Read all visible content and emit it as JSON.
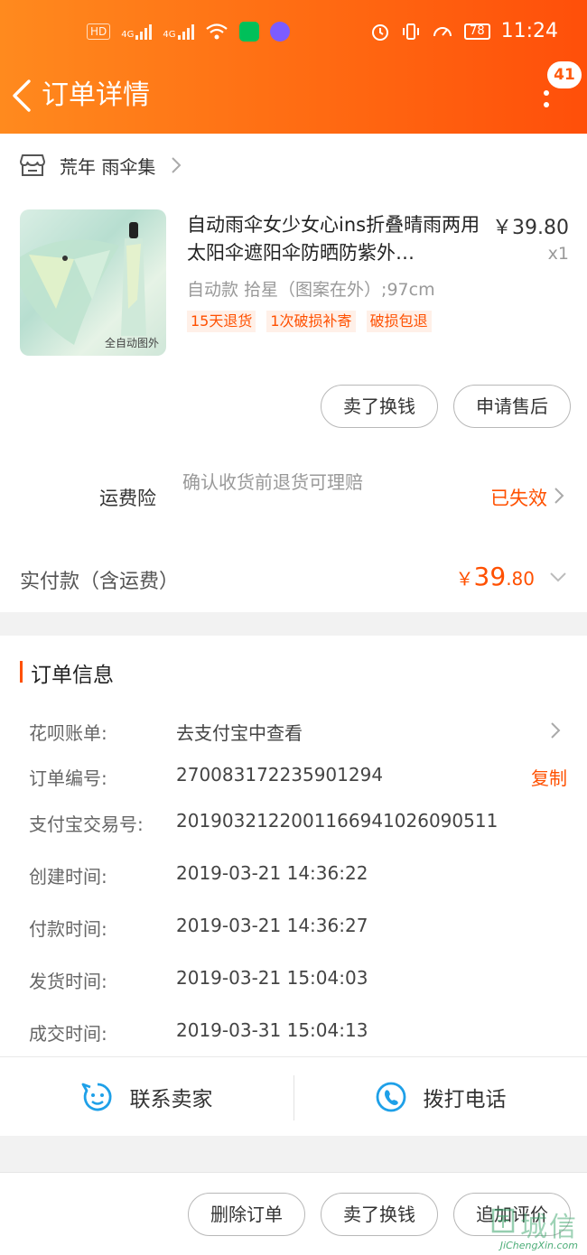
{
  "status_bar": {
    "left_chips": [
      "HD",
      "4G",
      "4G"
    ],
    "battery": "78",
    "time": "11:24"
  },
  "header": {
    "title": "订单详情",
    "notification_count": "41"
  },
  "store": {
    "name": "荒年 雨伞集"
  },
  "product": {
    "title": "自动雨伞女少女心ins折叠晴雨两用太阳伞遮阳伞防晒防紫外…",
    "price": "￥39.80",
    "quantity": "x1",
    "sku": "自动款 拾星（图案在外）;97cm",
    "image_label": "全自动图外",
    "tags": [
      "15天退货",
      "1次破损补寄",
      "破损包退"
    ]
  },
  "item_actions": {
    "sell_label": "卖了换钱",
    "after_sale_label": "申请售后"
  },
  "insurance": {
    "label": "运费险",
    "description": "确认收货前退货可理赔",
    "status": "已失效"
  },
  "payment": {
    "label": "实付款（含运费）",
    "currency": "￥",
    "amount_int": "39",
    "amount_dec": ".80"
  },
  "order_info": {
    "title": "订单信息",
    "rows": [
      {
        "label": "花呗账单:",
        "value": "去支付宝中查看"
      },
      {
        "label": "订单编号:",
        "value": "270083172235901294",
        "action": "复制"
      },
      {
        "label": "支付宝交易号:",
        "value": "2019032122001166941026090511"
      },
      {
        "label": "创建时间:",
        "value": "2019-03-21 14:36:22"
      },
      {
        "label": "付款时间:",
        "value": "2019-03-21 14:36:27"
      },
      {
        "label": "发货时间:",
        "value": "2019-03-21 15:04:03"
      },
      {
        "label": "成交时间:",
        "value": "2019-03-31 15:04:13"
      }
    ]
  },
  "contact": {
    "seller_label": "联系卖家",
    "phone_label": "拨打电话"
  },
  "bottom_bar": {
    "delete_label": "删除订单",
    "sell_label": "卖了换钱",
    "review_label": "追加评价"
  },
  "watermark": {
    "text": "城信",
    "url": "JiChengXin.com"
  },
  "colors": {
    "accent": "#ff5000",
    "header_start": "#ff8a1e",
    "header_end": "#ff4f0a",
    "contact_icon": "#1ea0e8"
  }
}
